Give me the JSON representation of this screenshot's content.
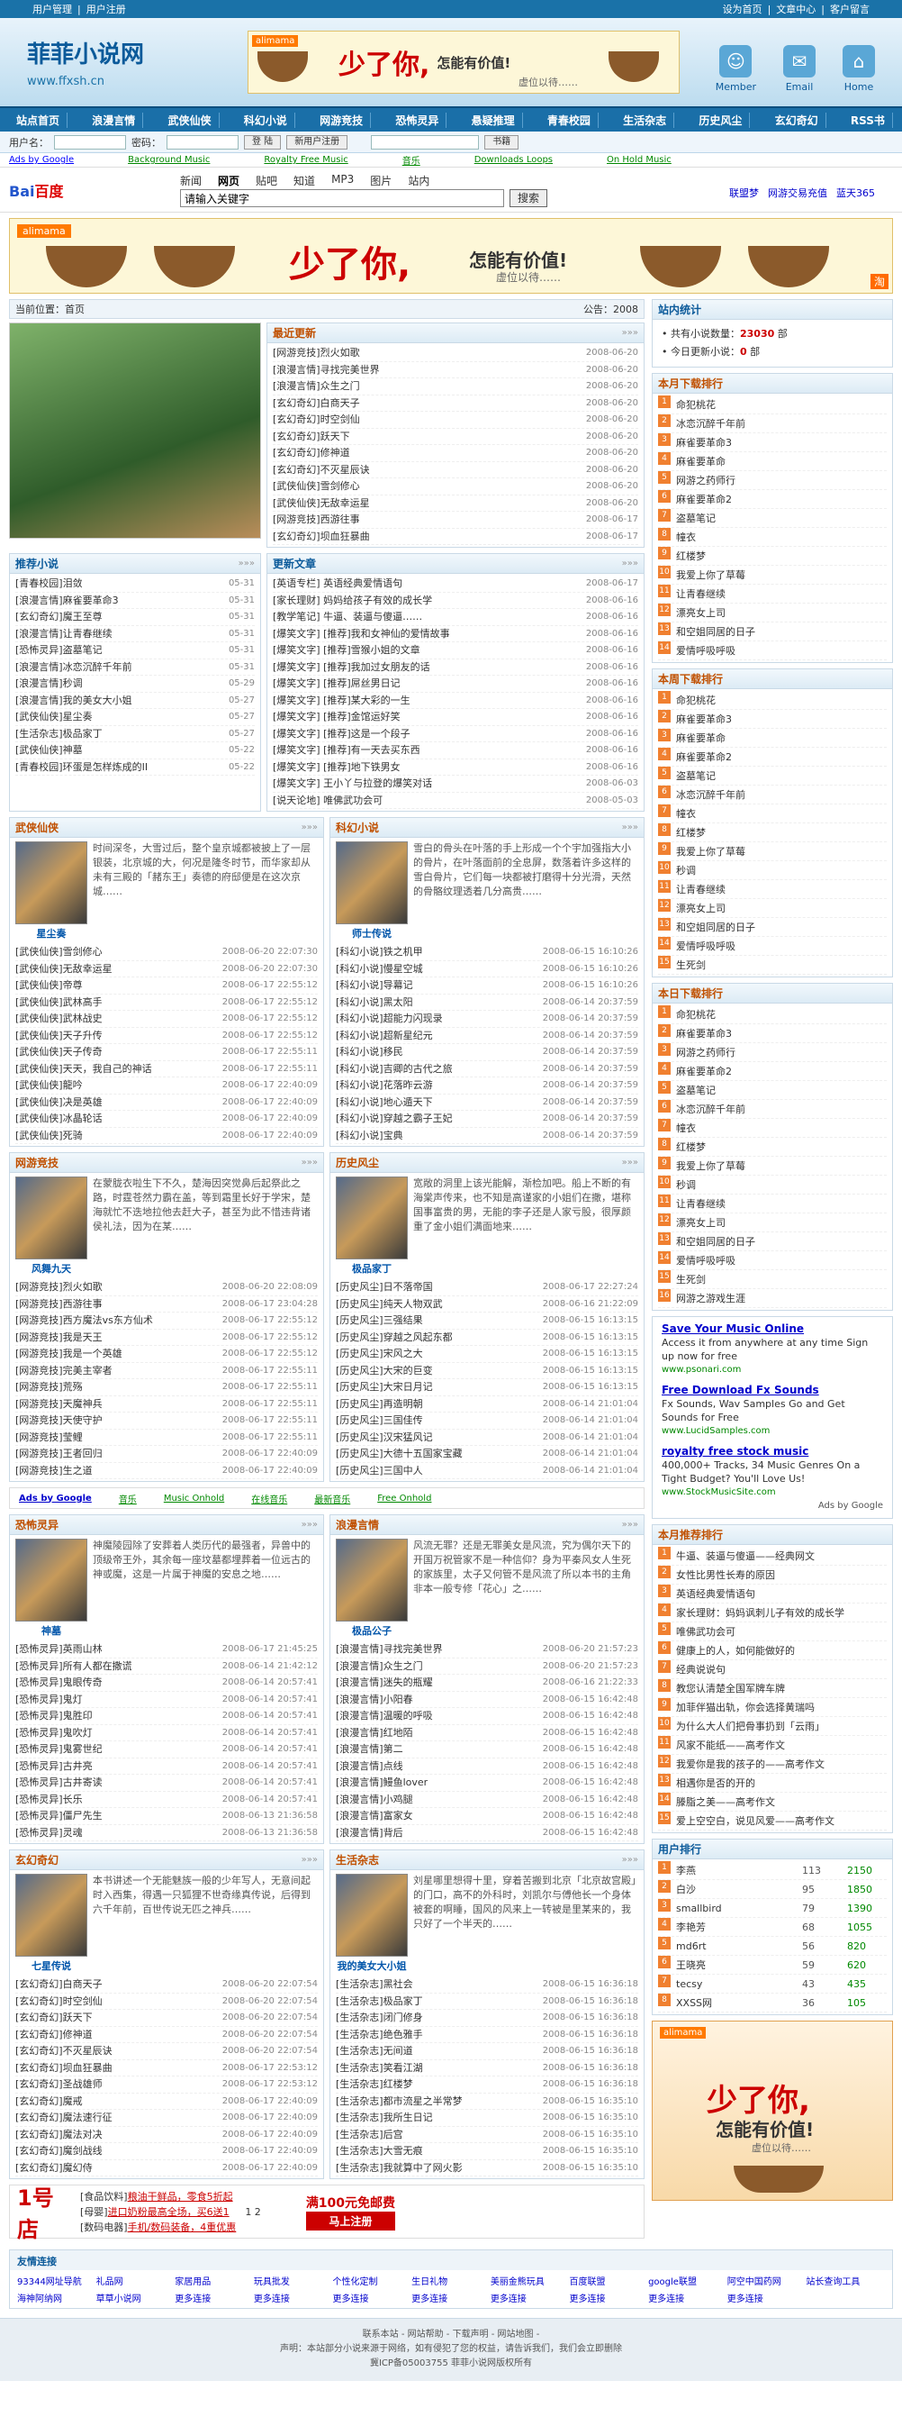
{
  "topbar": {
    "left": [
      "用户管理",
      "用户注册"
    ],
    "right": [
      "设为首页",
      "文章中心",
      "客户留言"
    ]
  },
  "header": {
    "logo": "菲菲小说网",
    "url": "www.ffxsh.cn",
    "icons": [
      {
        "label": "Member",
        "icon": "member-icon"
      },
      {
        "label": "Email",
        "icon": "email-icon"
      },
      {
        "label": "Home",
        "icon": "home-icon"
      }
    ]
  },
  "banner": {
    "brand": "alimama",
    "big": "少了你,",
    "slogan": "怎能有价值!",
    "sub": "虚位以待……",
    "tao": "淘"
  },
  "nav": [
    "站点首页",
    "浪漫言情",
    "武侠仙侠",
    "科幻小说",
    "网游竞技",
    "恐怖灵异",
    "悬疑推理",
    "青春校园",
    "生活杂志",
    "历史风尘",
    "玄幻奇幻",
    "RSS书"
  ],
  "login": {
    "user_label": "用户名：",
    "pass_label": "密码：",
    "btn1": "登 陆",
    "btn2": "新用户注册",
    "select": "书籍"
  },
  "adlinks": {
    "ag": "Ads by Google",
    "links": [
      "Background Music",
      "Royalty Free Music",
      "音乐",
      "Downloads Loops",
      "On Hold Music"
    ]
  },
  "baidu": {
    "logo1": "Bai",
    "logo2": "百度",
    "tabs": [
      "新闻",
      "网页",
      "贴吧",
      "知道",
      "MP3",
      "图片",
      "站内"
    ],
    "placeholder": "请输入关键字",
    "btn": "搜索",
    "links": [
      "联盟梦",
      "网游交易充值",
      "蓝天365"
    ]
  },
  "pos": {
    "label": "当前位置：首页",
    "notice": "公告：2008"
  },
  "latest": {
    "title": "最近更新",
    "items": [
      [
        "[网游竞技]烈火如歌",
        "2008-06-20"
      ],
      [
        "[浪漫言情]寻找完美世界",
        "2008-06-20"
      ],
      [
        "[浪漫言情]众生之门",
        "2008-06-20"
      ],
      [
        "[玄幻奇幻]白商天子",
        "2008-06-20"
      ],
      [
        "[玄幻奇幻]时空剑仙",
        "2008-06-20"
      ],
      [
        "[玄幻奇幻]跃天下",
        "2008-06-20"
      ],
      [
        "[玄幻奇幻]修神道",
        "2008-06-20"
      ],
      [
        "[玄幻奇幻]不灭星辰诀",
        "2008-06-20"
      ],
      [
        "[武侠仙侠]雪剑修心",
        "2008-06-20"
      ],
      [
        "[武侠仙侠]无敌幸运星",
        "2008-06-20"
      ],
      [
        "[网游竞技]西游往事",
        "2008-06-17"
      ],
      [
        "[玄幻奇幻]坝血狂暴曲",
        "2008-06-17"
      ]
    ]
  },
  "recommend": {
    "title": "推荐小说",
    "items": [
      [
        "[青春校园]泪敛",
        "05-31"
      ],
      [
        "[浪漫言情]麻雀要革命3",
        "05-31"
      ],
      [
        "[玄幻奇幻]魔王至尊",
        "05-31"
      ],
      [
        "[浪漫言情]让青春继续",
        "05-31"
      ],
      [
        "[恐怖灵异]盗墓笔记",
        "05-31"
      ],
      [
        "[浪漫言情]冰恋沉醉千年前",
        "05-31"
      ],
      [
        "[浪漫言情]秒调",
        "05-29"
      ],
      [
        "[浪漫言情]我的美女大小姐",
        "05-27"
      ],
      [
        "[武侠仙侠]星尘奏",
        "05-27"
      ],
      [
        "[生活杂志]极品家丁",
        "05-27"
      ],
      [
        "[武侠仙侠]神墓",
        "05-22"
      ],
      [
        "[青春校园]环蛋是怎样炼成的II",
        "05-22"
      ]
    ]
  },
  "articles": {
    "title": "更新文章",
    "items": [
      [
        "[英语专栏] 英语经典爱情语句",
        "2008-06-17"
      ],
      [
        "[家长理财] 妈妈给孩子有效的成长学",
        "2008-06-16"
      ],
      [
        "[教学笔记] 牛逼、装逼与傻逼……",
        "2008-06-16"
      ],
      [
        "[爆笑文字] [推荐]我和女神仙的爱情故事",
        "2008-06-16"
      ],
      [
        "[爆笑文字] [推荐]雪猴小姐的文章",
        "2008-06-16"
      ],
      [
        "[爆笑文字] [推荐]我加过女朋友的话",
        "2008-06-16"
      ],
      [
        "[爆笑文字] [推荐]屌丝男日记",
        "2008-06-16"
      ],
      [
        "[爆笑文字] [推荐]某大彩的一生",
        "2008-06-16"
      ],
      [
        "[爆笑文字] [推荐]金馆运好笑",
        "2008-06-16"
      ],
      [
        "[爆笑文字] [推荐]这是一个段子",
        "2008-06-16"
      ],
      [
        "[爆笑文字] [推荐]有一天去买东西",
        "2008-06-16"
      ],
      [
        "[爆笑文字] [推荐]地下铁男女",
        "2008-06-16"
      ],
      [
        "[爆笑文字] 王小丫与拉登的爆笑对话",
        "2008-06-03"
      ],
      [
        "[说天论地] 唯佛武功会可",
        "2008-05-03"
      ]
    ]
  },
  "wuxia": {
    "title": "武侠仙侠",
    "book": "星尘奏",
    "desc": "时间深冬，大雪过后，整个皇京城都被披上了一层银装，北京城的大，何况是隆冬时节，而华家却从未有三殿的「赭东王」奏德的府邸便是在这次京城……",
    "items": [
      [
        "[武侠仙侠]雪剑修心",
        "2008-06-20 22:07:30"
      ],
      [
        "[武侠仙侠]无敌幸运星",
        "2008-06-20 22:07:30"
      ],
      [
        "[武侠仙侠]帝尊",
        "2008-06-17 22:55:12"
      ],
      [
        "[武侠仙侠]武林高手",
        "2008-06-17 22:55:12"
      ],
      [
        "[武侠仙侠]武林战史",
        "2008-06-17 22:55:12"
      ],
      [
        "[武侠仙侠]天子升传",
        "2008-06-17 22:55:12"
      ],
      [
        "[武侠仙侠]天子传奇",
        "2008-06-17 22:55:11"
      ],
      [
        "[武侠仙侠]天天，我自己的神话",
        "2008-06-17 22:55:11"
      ],
      [
        "[武侠仙侠]龍吟",
        "2008-06-17 22:40:09"
      ],
      [
        "[武侠仙侠]决是英雄",
        "2008-06-17 22:40:09"
      ],
      [
        "[武侠仙侠]冰晶轮话",
        "2008-06-17 22:40:09"
      ],
      [
        "[武侠仙侠]死骑",
        "2008-06-17 22:40:09"
      ]
    ]
  },
  "scifi": {
    "title": "科幻小说",
    "book": "师士传说",
    "desc": "雪白的骨头在叶落的手上形成一个个宇加强指大小的骨片，在叶落面前的全息屏，数落着许多这样的雪白骨片，它们每一块都被打磨得十分光滑，天然的骨骼纹理透着几分高贵……",
    "items": [
      [
        "[科幻小说]铁之机甲",
        "2008-06-15 16:10:26"
      ],
      [
        "[科幻小说]慢星空城",
        "2008-06-15 16:10:26"
      ],
      [
        "[科幻小说]导幕记",
        "2008-06-15 16:10:26"
      ],
      [
        "[科幻小说]黑太阳",
        "2008-06-14 20:37:59"
      ],
      [
        "[科幻小说]超能力闪现录",
        "2008-06-14 20:37:59"
      ],
      [
        "[科幻小说]超新星纪元",
        "2008-06-14 20:37:59"
      ],
      [
        "[科幻小说]移民",
        "2008-06-14 20:37:59"
      ],
      [
        "[科幻小说]吉卿的古代之旅",
        "2008-06-14 20:37:59"
      ],
      [
        "[科幻小说]花落昨云游",
        "2008-06-14 20:37:59"
      ],
      [
        "[科幻小说]地心遁天下",
        "2008-06-14 20:37:59"
      ],
      [
        "[科幻小说]穿越之霸子王妃",
        "2008-06-14 20:37:59"
      ],
      [
        "[科幻小说]宝典",
        "2008-06-14 20:37:59"
      ]
    ]
  },
  "game": {
    "title": "网游竞技",
    "book": "风舞九天",
    "desc": "在蒙胧衣啦生下不久，楚海因突觉鼻后起祭此之路，时霆苍然力霸在盖，等到霜里长好于学宋，楚海就忙不迭地拉他去赶大子，甚至为此不惜违背诸侯礼法，因为在某……",
    "items": [
      [
        "[网游竞技]烈火如歌",
        "2008-06-20 22:08:09"
      ],
      [
        "[网游竞技]西游往事",
        "2008-06-17 23:04:28"
      ],
      [
        "[网游竞技]西方魔法vs东方仙术",
        "2008-06-17 22:55:12"
      ],
      [
        "[网游竞技]我是天王",
        "2008-06-17 22:55:12"
      ],
      [
        "[网游竞技]我是一个英雄",
        "2008-06-17 22:55:12"
      ],
      [
        "[网游竞技]完美主宰者",
        "2008-06-17 22:55:11"
      ],
      [
        "[网游竞技]荒殇",
        "2008-06-17 22:55:11"
      ],
      [
        "[网游竞技]天魔神兵",
        "2008-06-17 22:55:11"
      ],
      [
        "[网游竞技]天使守护",
        "2008-06-17 22:55:11"
      ],
      [
        "[网游竞技]莹鲤",
        "2008-06-17 22:55:11"
      ],
      [
        "[网游竞技]王者回归",
        "2008-06-17 22:40:09"
      ],
      [
        "[网游竞技]生之道",
        "2008-06-17 22:40:09"
      ]
    ]
  },
  "history": {
    "title": "历史风尘",
    "book": "极品家丁",
    "desc": "宽敞的洞里上该光能解，渐检加吧。船上不断的有海棠声传来，也不知是高谨家的小姐们在撒，堪称国事富贵的男，无能的李子还是人家亏股，很厚颜重了金小姐们满面地来……",
    "items": [
      [
        "[历史风尘]日不落帝国",
        "2008-06-17 22:27:24"
      ],
      [
        "[历史风尘]纯天人物双武",
        "2008-06-16 21:22:09"
      ],
      [
        "[历史风尘]三强结果",
        "2008-06-15 16:13:15"
      ],
      [
        "[历史风尘]穿越之风起东都",
        "2008-06-15 16:13:15"
      ],
      [
        "[历史风尘]宋风之大",
        "2008-06-15 16:13:15"
      ],
      [
        "[历史风尘]大宋的巨变",
        "2008-06-15 16:13:15"
      ],
      [
        "[历史风尘]大宋日月记",
        "2008-06-15 16:13:15"
      ],
      [
        "[历史风尘]再造明朝",
        "2008-06-14 21:01:04"
      ],
      [
        "[历史风尘]三国佳传",
        "2008-06-14 21:01:04"
      ],
      [
        "[历史风尘]汉宋猛风记",
        "2008-06-14 21:01:04"
      ],
      [
        "[历史风尘]大德十五国家宝藏",
        "2008-06-14 21:01:04"
      ],
      [
        "[历史风尘]三国中人",
        "2008-06-14 21:01:04"
      ]
    ]
  },
  "adsby": {
    "ag": "Ads by Google",
    "links": [
      "音乐",
      "Music Onhold",
      "在线音乐",
      "最新音乐",
      "Free Onhold"
    ]
  },
  "horror": {
    "title": "恐怖灵异",
    "book": "神墓",
    "desc": "神魔陵园除了安葬着人类历代的最强者，异兽中的顶级帝王外，其余每一座坟墓都埋葬着一位远古的神或魔，这是一片属于神魔的安息之地……",
    "items": [
      [
        "[恐怖灵异]英雨山林",
        "2008-06-17 21:45:25"
      ],
      [
        "[恐怖灵异]所有人都在撒谎",
        "2008-06-14 21:42:12"
      ],
      [
        "[恐怖灵异]鬼眼传奇",
        "2008-06-14 20:57:41"
      ],
      [
        "[恐怖灵异]鬼灯",
        "2008-06-14 20:57:41"
      ],
      [
        "[恐怖灵异]鬼胜印",
        "2008-06-14 20:57:41"
      ],
      [
        "[恐怖灵异]鬼吹灯",
        "2008-06-14 20:57:41"
      ],
      [
        "[恐怖灵异]鬼雾世纪",
        "2008-06-14 20:57:41"
      ],
      [
        "[恐怖灵异]古井亮",
        "2008-06-14 20:57:41"
      ],
      [
        "[恐怖灵异]古井寄读",
        "2008-06-14 20:57:41"
      ],
      [
        "[恐怖灵异]长乐",
        "2008-06-14 20:57:41"
      ],
      [
        "[恐怖灵异]僵尸先生",
        "2008-06-13 21:36:58"
      ],
      [
        "[恐怖灵异]灵魂",
        "2008-06-13 21:36:58"
      ]
    ]
  },
  "romance": {
    "title": "浪漫言情",
    "book": "极品公子",
    "desc": "风流无罪？还是无罪美女是风流，究为偶尔天下的开国万祝管家不是一种信仰？身为平秦风女人生死的家族里，太子又何管不是风流了所以本书的主角非本一般专修「花心」之……",
    "items": [
      [
        "[浪漫言情]寻找完美世界",
        "2008-06-20 21:57:23"
      ],
      [
        "[浪漫言情]众生之门",
        "2008-06-20 21:57:23"
      ],
      [
        "[浪漫言情]迷失的瓶耀",
        "2008-06-16 21:22:33"
      ],
      [
        "[浪漫言情]小阳春",
        "2008-06-15 16:42:48"
      ],
      [
        "[浪漫言情]温暖的呼吸",
        "2008-06-15 16:42:48"
      ],
      [
        "[浪漫言情]红地陌",
        "2008-06-15 16:42:48"
      ],
      [
        "[浪漫言情]第二",
        "2008-06-15 16:42:48"
      ],
      [
        "[浪漫言情]点线",
        "2008-06-15 16:42:48"
      ],
      [
        "[浪漫言情]鳗鱼lover",
        "2008-06-15 16:42:48"
      ],
      [
        "[浪漫言情]小鸡腿",
        "2008-06-15 16:42:48"
      ],
      [
        "[浪漫言情]富家女",
        "2008-06-15 16:42:48"
      ],
      [
        "[浪漫言情]背后",
        "2008-06-15 16:42:48"
      ]
    ]
  },
  "fantasy": {
    "title": "玄幻奇幻",
    "book": "七星传说",
    "desc": "本书讲述一个无能魅族一般的少年写人，无意间起时入西集，得遇一只狐狸不世奇缘真传说，后得到六千年前，百世传说无匹之神兵……",
    "items": [
      [
        "[玄幻奇幻]白商天子",
        "2008-06-20 22:07:54"
      ],
      [
        "[玄幻奇幻]时空剑仙",
        "2008-06-20 22:07:54"
      ],
      [
        "[玄幻奇幻]跃天下",
        "2008-06-20 22:07:54"
      ],
      [
        "[玄幻奇幻]修神道",
        "2008-06-20 22:07:54"
      ],
      [
        "[玄幻奇幻]不灭星辰诀",
        "2008-06-20 22:07:54"
      ],
      [
        "[玄幻奇幻]坝血狂暴曲",
        "2008-06-17 22:53:12"
      ],
      [
        "[玄幻奇幻]圣战雄师",
        "2008-06-17 22:53:12"
      ],
      [
        "[玄幻奇幻]魔戒",
        "2008-06-17 22:40:09"
      ],
      [
        "[玄幻奇幻]魔法速行征",
        "2008-06-17 22:40:09"
      ],
      [
        "[玄幻奇幻]魔法对决",
        "2008-06-17 22:40:09"
      ],
      [
        "[玄幻奇幻]魔剑战线",
        "2008-06-17 22:40:09"
      ],
      [
        "[玄幻奇幻]魔幻侍",
        "2008-06-17 22:40:09"
      ]
    ]
  },
  "life": {
    "title": "生活杂志",
    "book": "我的美女大小姐",
    "desc": "刘星哪里想得十里，穿着苦搬到北京「北京故宫殿」的门口，高不的外科时，刘凯尔与傅他长一个身体被套的啊睡，国风的风来上一转被是里某来的，我只好了一个半天的……",
    "items": [
      [
        "[生活杂志]黑社会",
        "2008-06-15 16:36:18"
      ],
      [
        "[生活杂志]极品家丁",
        "2008-06-15 16:36:18"
      ],
      [
        "[生活杂志]闭门修身",
        "2008-06-15 16:36:18"
      ],
      [
        "[生活杂志]绝色雅手",
        "2008-06-15 16:36:18"
      ],
      [
        "[生活杂志]无间道",
        "2008-06-15 16:36:18"
      ],
      [
        "[生活杂志]笑看江湖",
        "2008-06-15 16:36:18"
      ],
      [
        "[生活杂志]红楼梦",
        "2008-06-15 16:36:18"
      ],
      [
        "[生活杂志]都市流星之半常梦",
        "2008-06-15 16:35:10"
      ],
      [
        "[生活杂志]我所生日记",
        "2008-06-15 16:35:10"
      ],
      [
        "[生活杂志]后宫",
        "2008-06-15 16:35:10"
      ],
      [
        "[生活杂志]大雪无痕",
        "2008-06-15 16:35:10"
      ],
      [
        "[生活杂志]我就算中了网火影",
        "2008-06-15 16:35:10"
      ]
    ]
  },
  "promo": {
    "logo": "1号店",
    "lines": [
      [
        "[食品饮料]",
        "粮油干鲜品，零食5折起"
      ],
      [
        "[母婴]",
        "进口奶粉最高全场，买6送1"
      ],
      [
        "[数码电器]",
        "手机/数码装备，4重优惠"
      ]
    ],
    "big": "满100元免邮费",
    "reg": "马上注册",
    "pages": "1 2"
  },
  "stats": {
    "title": "站内统计",
    "total_label": "共有小说数量：",
    "total": "23030",
    "total_unit": " 部",
    "today_label": "今日更新小说：",
    "today": "0",
    "today_unit": " 部"
  },
  "monthrank": {
    "title": "本月下载排行",
    "items": [
      "命犯桃花",
      "冰恋沉醉千年前",
      "麻雀要革命3",
      "麻雀要革命",
      "网游之药师行",
      "麻雀要革命2",
      "盗墓笔记",
      "幢衣",
      "红楼梦",
      "我爱上你了草莓",
      "让青春继续",
      "漂亮女上司",
      "和空姐同居的日子",
      "爱情呼吸呼吸"
    ]
  },
  "weekrank": {
    "title": "本周下载排行",
    "items": [
      "命犯桃花",
      "麻雀要革命3",
      "麻雀要革命",
      "麻雀要革命2",
      "盗墓笔记",
      "冰恋沉醉千年前",
      "幢衣",
      "红楼梦",
      "我爱上你了草莓",
      "秒调",
      "让青春继续",
      "漂亮女上司",
      "和空姐同居的日子",
      "爱情呼吸呼吸",
      "生死剑"
    ]
  },
  "dayrank": {
    "title": "本日下载排行",
    "items": [
      "命犯桃花",
      "麻雀要革命3",
      "网游之药师行",
      "麻雀要革命2",
      "盗墓笔记",
      "冰恋沉醉千年前",
      "幢衣",
      "红楼梦",
      "我爱上你了草莓",
      "秒调",
      "让青春继续",
      "漂亮女上司",
      "和空姐同居的日子",
      "爱情呼吸呼吸",
      "生死剑",
      "网游之游戏生涯"
    ]
  },
  "gads": [
    {
      "title": "Save Your Music Online",
      "text": "Access it from anywhere at any time Sign up now for free",
      "url": "www.psonari.com"
    },
    {
      "title": "Free Download Fx Sounds",
      "text": "Fx Sounds, Wav Samples Go and Get Sounds for Free",
      "url": "www.LucidSamples.com"
    },
    {
      "title": "royalty free stock music",
      "text": "400,000+ Tracks, 34 Music Genres On a Tight Budget? You'll Love Us!",
      "url": "www.StockMusicSite.com"
    }
  ],
  "gads_label": "Ads by Google",
  "monthrec": {
    "title": "本月推荐排行",
    "items": [
      "牛逼、装逼与傻逼——经典网文",
      "女性比男性长寿的原因",
      "英语经典爱情语句",
      "家长理财：妈妈讽刺儿子有效的成长学",
      "唯佛武功会可",
      "健康上的人，如何能做好的",
      "经典说说句",
      "教您认清楚全国军牌车牌",
      "加菲伴猫出轨，你会选择黄瑞吗",
      "为什么大人们把骨事扔到「云雨」",
      "风家不能纸——高考作文",
      "我爱你是我的孩子的——高考作文",
      "相遇你是否的开的",
      "滕脂之美——高考作文",
      "爱上空空白，说见风爱——高考作文"
    ]
  },
  "users": {
    "title": "用户排行",
    "items": [
      [
        "李燕",
        "113",
        "2150"
      ],
      [
        "白沙",
        "95",
        "1850"
      ],
      [
        "smallbird",
        "79",
        "1390"
      ],
      [
        "李艳芳",
        "68",
        "1055"
      ],
      [
        "md6rt",
        "56",
        "820"
      ],
      [
        "王晓亮",
        "59",
        "620"
      ],
      [
        "tecsy",
        "43",
        "435"
      ],
      [
        "XXSS网",
        "36",
        "105"
      ]
    ]
  },
  "friend": {
    "title": "友情连接",
    "links": [
      "93344网址导航",
      "礼品网",
      "家居用品",
      "玩具批发",
      "个性化定制",
      "生日礼物",
      "美丽金熊玩具",
      "百度联盟",
      "google联盟",
      "阿空中国药网",
      "站长查询工具",
      "海神阿纳网",
      "草草小说网",
      "更多连接",
      "更多连接",
      "更多连接",
      "更多连接",
      "更多连接",
      "更多连接",
      "更多连接",
      "更多连接"
    ]
  },
  "footer": {
    "l1": "联系本站 - 网站帮助 - 下载声明 - 网站地图 -",
    "l2": "声明：本站部分小说来源于网络，如有侵犯了您的权益，请告诉我们，我们会立即删除",
    "l3": "冀ICP备05003755  菲菲小说网版权所有"
  }
}
